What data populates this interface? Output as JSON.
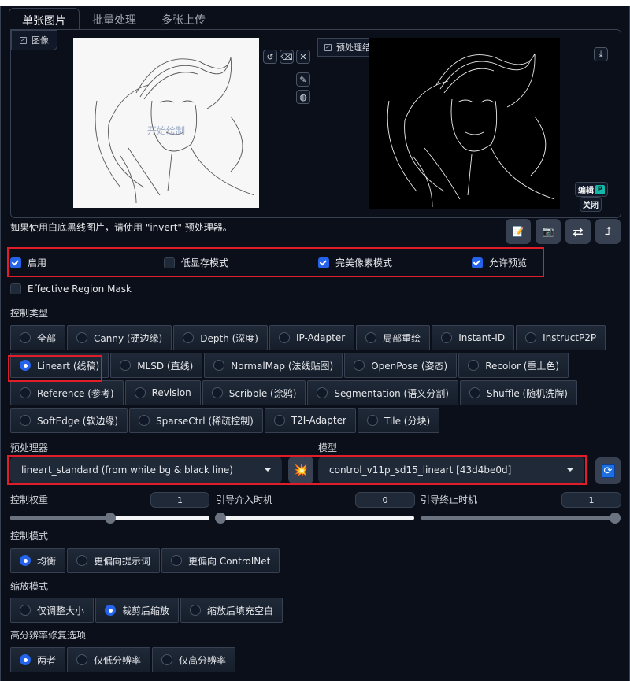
{
  "tabs": [
    {
      "label": "单张图片",
      "active": true
    },
    {
      "label": "批量处理",
      "active": false
    },
    {
      "label": "多张上传",
      "active": false
    }
  ],
  "image_panel": {
    "label": "图像",
    "label_icon": "image-icon",
    "watermark": "开始绘制",
    "tools": [
      {
        "name": "undo-icon",
        "glyph": "↺"
      },
      {
        "name": "eraser-icon",
        "glyph": "⌫"
      },
      {
        "name": "close-icon",
        "glyph": "✕"
      },
      {
        "name": "brush-icon",
        "glyph": "✎"
      },
      {
        "name": "palette-icon",
        "glyph": "◍"
      }
    ]
  },
  "preview_panel": {
    "label": "预处理结果预览",
    "label_icon": "image-icon",
    "download_icon": "download-icon",
    "edit_label": "编辑",
    "edit_badge": "P",
    "close_label": "关闭"
  },
  "hint": "如果使用白底黑线图片，请使用 \"invert\" 预处理器。",
  "action_buttons": [
    {
      "name": "notepad-icon",
      "glyph": "📝"
    },
    {
      "name": "camera-icon",
      "glyph": "📷"
    },
    {
      "name": "swap-icon",
      "glyph": "⇄"
    },
    {
      "name": "send-up-icon",
      "glyph": "⮥"
    }
  ],
  "options": [
    {
      "label": "启用",
      "checked": true
    },
    {
      "label": "低显存模式",
      "checked": false
    },
    {
      "label": "完美像素模式",
      "checked": true
    },
    {
      "label": "允许预览",
      "checked": true
    }
  ],
  "effective_region_mask": {
    "label": "Effective Region Mask",
    "checked": false
  },
  "control_type": {
    "label": "控制类型",
    "options": [
      {
        "label": "全部",
        "checked": false
      },
      {
        "label": "Canny (硬边缘)",
        "checked": false
      },
      {
        "label": "Depth (深度)",
        "checked": false
      },
      {
        "label": "IP-Adapter",
        "checked": false
      },
      {
        "label": "局部重绘",
        "checked": false
      },
      {
        "label": "Instant-ID",
        "checked": false
      },
      {
        "label": "InstructP2P",
        "checked": false
      },
      {
        "label": "Lineart (线稿)",
        "checked": true
      },
      {
        "label": "MLSD (直线)",
        "checked": false
      },
      {
        "label": "NormalMap (法线贴图)",
        "checked": false
      },
      {
        "label": "OpenPose (姿态)",
        "checked": false
      },
      {
        "label": "Recolor (重上色)",
        "checked": false
      },
      {
        "label": "Reference (参考)",
        "checked": false
      },
      {
        "label": "Revision",
        "checked": false
      },
      {
        "label": "Scribble (涂鸦)",
        "checked": false
      },
      {
        "label": "Segmentation (语义分割)",
        "checked": false
      },
      {
        "label": "Shuffle (随机洗牌)",
        "checked": false
      },
      {
        "label": "SoftEdge (软边缘)",
        "checked": false
      },
      {
        "label": "SparseCtrl (稀疏控制)",
        "checked": false
      },
      {
        "label": "T2I-Adapter",
        "checked": false
      },
      {
        "label": "Tile (分块)",
        "checked": false
      }
    ]
  },
  "preprocessor": {
    "label": "预处理器",
    "value": "lineart_standard (from white bg & black line)",
    "run_icon": "explosion-icon"
  },
  "model": {
    "label": "模型",
    "value": "control_v11p_sd15_lineart [43d4be0d]",
    "refresh_icon": "refresh-icon"
  },
  "sliders": [
    {
      "label": "控制权重",
      "value": "1",
      "fraction": 0.5
    },
    {
      "label": "引导介入时机",
      "value": "0",
      "fraction": 0.0
    },
    {
      "label": "引导终止时机",
      "value": "1",
      "fraction": 1.0
    }
  ],
  "control_mode": {
    "label": "控制模式",
    "options": [
      {
        "label": "均衡",
        "checked": true
      },
      {
        "label": "更偏向提示词",
        "checked": false
      },
      {
        "label": "更偏向 ControlNet",
        "checked": false
      }
    ]
  },
  "resize_mode": {
    "label": "缩放模式",
    "options": [
      {
        "label": "仅调整大小",
        "checked": false
      },
      {
        "label": "裁剪后缩放",
        "checked": true
      },
      {
        "label": "缩放后填充空白",
        "checked": false
      }
    ]
  },
  "hires_fix": {
    "label": "高分辨率修复选项",
    "options": [
      {
        "label": "两者",
        "checked": true
      },
      {
        "label": "仅低分辨率",
        "checked": false
      },
      {
        "label": "仅高分辨率",
        "checked": false
      }
    ]
  },
  "colors": {
    "accent": "#2563eb",
    "highlight": "#e11d2a",
    "background": "#0b0f19"
  }
}
